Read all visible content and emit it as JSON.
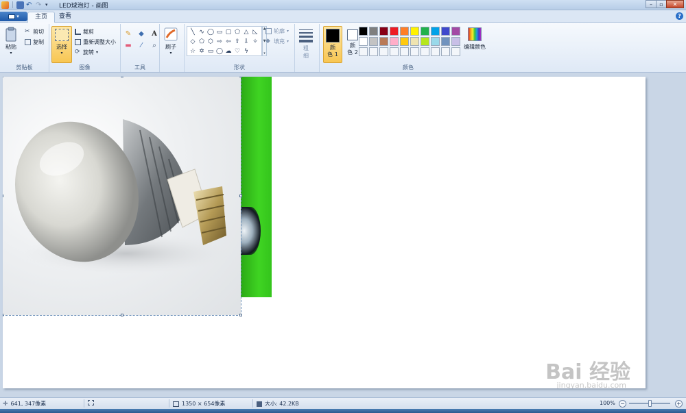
{
  "window": {
    "title": "LED球泡灯 - 画图",
    "controls": {
      "minimize": "–",
      "maximize": "▫",
      "close": "✕"
    }
  },
  "tabs": [
    {
      "label": "主页",
      "active": true
    },
    {
      "label": "查看",
      "active": false
    }
  ],
  "ribbon": {
    "clipboard": {
      "label": "剪贴板",
      "paste": "粘贴",
      "cut": "剪切",
      "copy": "复制"
    },
    "image": {
      "label": "图像",
      "select": "选择",
      "crop": "裁剪",
      "resize": "重新调整大小",
      "rotate": "旋转"
    },
    "tools": {
      "label": "工具"
    },
    "brushes": {
      "label": "刷子"
    },
    "shapes": {
      "label": "形状",
      "outline": "轮廓",
      "fill": "填充"
    },
    "size": {
      "label_line1": "粗",
      "label_line2": "细"
    },
    "colors": {
      "label": "颜色",
      "color1_line1": "颜",
      "color1_line2": "色 1",
      "color2_line1": "颜",
      "color2_line2": "色 2",
      "edit": "编辑颜色",
      "color1_value": "#000000",
      "color2_value": "#ffffff",
      "palette_row1": [
        "#000000",
        "#7f7f7f",
        "#880015",
        "#ed1c24",
        "#ff7f27",
        "#fff200",
        "#22b14c",
        "#00a2e8",
        "#3f48cc",
        "#a349a4"
      ],
      "palette_row2": [
        "#ffffff",
        "#c3c3c3",
        "#b97a57",
        "#ffaec9",
        "#ffc90e",
        "#efe4b0",
        "#b5e61d",
        "#99d9ea",
        "#7092be",
        "#c8bfe7"
      ]
    }
  },
  "status": {
    "cursor": "641, 347像素",
    "dimensions": "1350 × 654像素",
    "filesize": "大小: 42.2KB",
    "zoom": "100%"
  },
  "watermark": {
    "brand": "Bai 经验",
    "url": "jingyan.baidu.com"
  }
}
